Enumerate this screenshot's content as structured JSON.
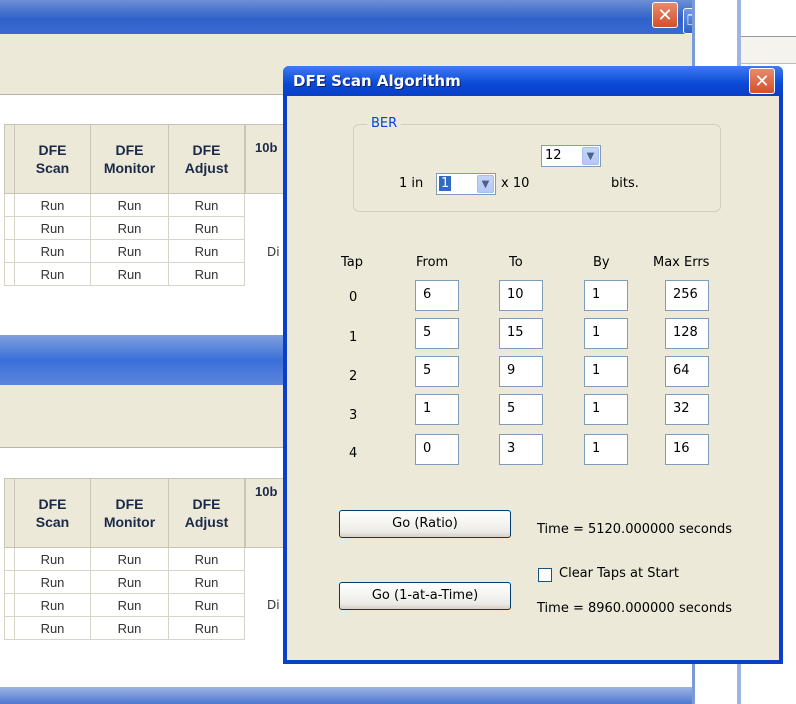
{
  "bg_table_top": {
    "header_partial": "10b",
    "columns": [
      "DFE\nScan",
      "DFE\nMonitor",
      "DFE\nAdjust"
    ],
    "rows": [
      [
        "Run",
        "Run",
        "Run"
      ],
      [
        "Run",
        "Run",
        "Run"
      ],
      [
        "Run",
        "Run",
        "Run"
      ],
      [
        "Run",
        "Run",
        "Run"
      ]
    ],
    "side_fragment": "Di"
  },
  "bg_table_bottom": {
    "header_partial": "10b",
    "columns": [
      "DFE\nScan",
      "DFE\nMonitor",
      "DFE\nAdjust"
    ],
    "rows": [
      [
        "Run",
        "Run",
        "Run"
      ],
      [
        "Run",
        "Run",
        "Run"
      ],
      [
        "Run",
        "Run",
        "Run"
      ],
      [
        "Run",
        "Run",
        "Run"
      ]
    ],
    "side_fragment": "Di"
  },
  "bg_window": {
    "close_glyph": "✕",
    "restore_glyph": "❐"
  },
  "dialog": {
    "title": "DFE Scan Algorithm",
    "close_glyph": "✕",
    "ber": {
      "group_label": "BER",
      "prefix": "1 in",
      "mantissa_value": "1",
      "times_label": "x 10",
      "exponent_value": "12",
      "suffix": "bits."
    },
    "taps_table": {
      "headers": [
        "Tap",
        "From",
        "To",
        "By",
        "Max Errs"
      ],
      "rows": [
        {
          "tap": "0",
          "from": "6",
          "to": "10",
          "by": "1",
          "max_errs": "256"
        },
        {
          "tap": "1",
          "from": "5",
          "to": "15",
          "by": "1",
          "max_errs": "128"
        },
        {
          "tap": "2",
          "from": "5",
          "to": "9",
          "by": "1",
          "max_errs": "64"
        },
        {
          "tap": "3",
          "from": "1",
          "to": "5",
          "by": "1",
          "max_errs": "32"
        },
        {
          "tap": "4",
          "from": "0",
          "to": "3",
          "by": "1",
          "max_errs": "16"
        }
      ]
    },
    "go_ratio_label": "Go (Ratio)",
    "go_ratio_time": "Time = 5120.000000 seconds",
    "clear_taps_label": "Clear Taps at Start",
    "clear_taps_checked": false,
    "go_one_label": "Go (1-at-a-Time)",
    "go_one_time": "Time = 8960.000000 seconds"
  },
  "colors": {
    "title_blue": "#0a3fc7",
    "dialog_face": "#ece9d8",
    "close_red": "#d4502a",
    "selection": "#316ac5"
  }
}
